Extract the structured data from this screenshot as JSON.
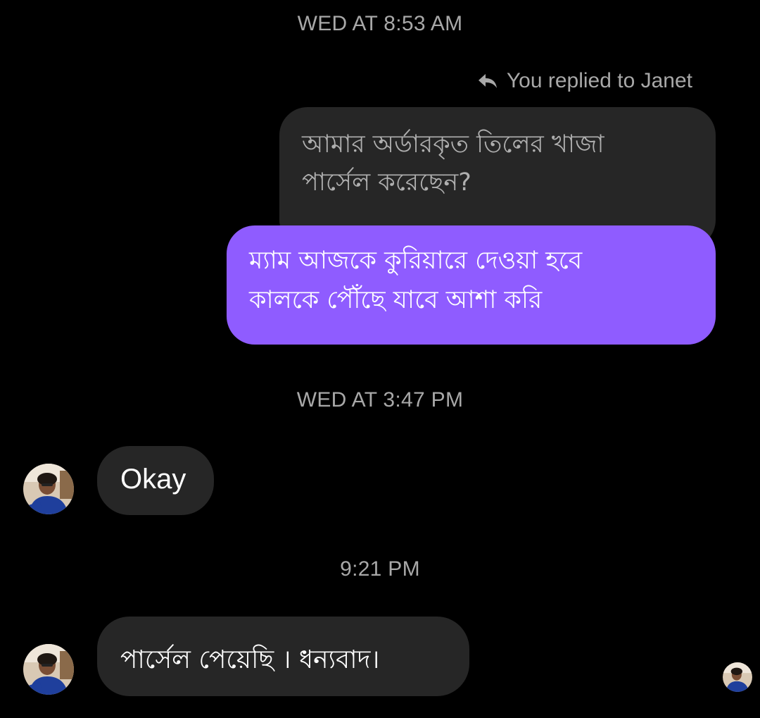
{
  "timestamps": {
    "first": "WED AT 8:53 AM",
    "second": "WED AT 3:47 PM",
    "third": "9:21 PM"
  },
  "reply": {
    "header": "You replied to Janet",
    "quoted_line1": "আমার অর্ডারকৃত তিলের খাজা",
    "quoted_line2": "পার্সেল করেছেন?",
    "message_line1": "ম্যাম আজকে কুরিয়ারে দেওয়া হবে",
    "message_line2": "কালকে পৌঁছে যাবে আশা করি"
  },
  "received": {
    "okay": "Okay",
    "parcel": "পার্সেল পেয়েছি । ধন্যবাদ।"
  },
  "icons": [
    "reply-arrow-icon",
    "contact-avatar",
    "seen-avatar"
  ],
  "colors": {
    "background": "#000000",
    "sent_bubble": "#8f5cff",
    "received_bubble": "#262626",
    "timestamp": "#a8a8a8"
  }
}
